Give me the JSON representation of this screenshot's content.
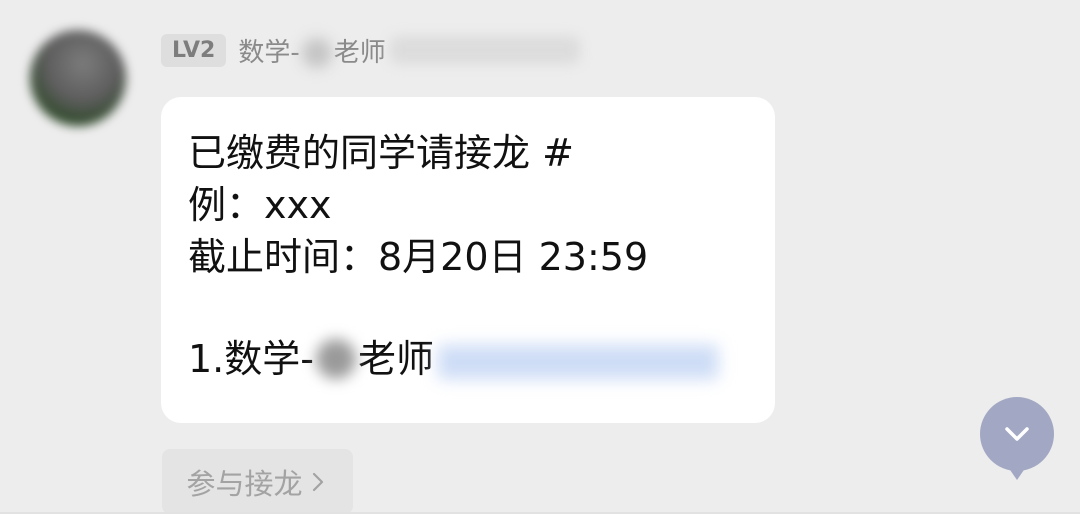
{
  "message": {
    "sender": {
      "level_badge": "LV2",
      "name_prefix": "数学-",
      "name_suffix": "老师"
    },
    "lines": [
      "已缴费的同学请接龙 #",
      "例：xxx",
      "截止时间：8月20日 23:59"
    ],
    "entry": {
      "prefix": "1.数学-",
      "suffix": "老师"
    }
  },
  "join_button": {
    "label": "参与接龙"
  },
  "scroll_button": {
    "icon": "chevron-down-icon"
  },
  "colors": {
    "background": "#ededed",
    "bubble": "#ffffff",
    "scroll_button": "#a2a8c3",
    "badge_bg": "#dedede"
  }
}
